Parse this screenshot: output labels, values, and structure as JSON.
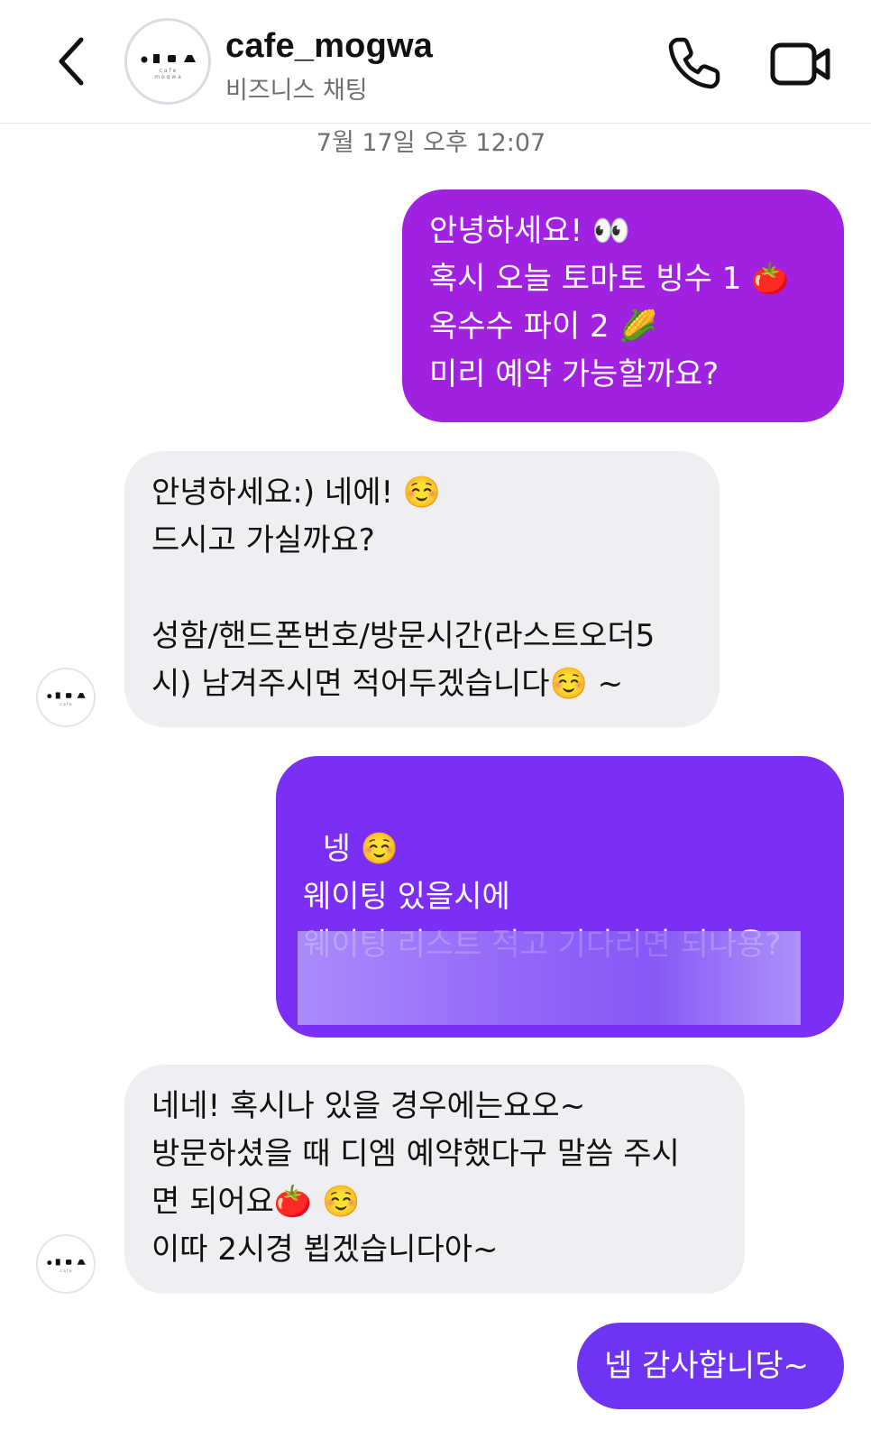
{
  "header": {
    "name": "cafe_mogwa",
    "subtitle": "비즈니스 채팅",
    "avatar_icon": "cafe-logo-icon",
    "back_icon": "chevron-left-icon",
    "call_icon": "phone-icon",
    "video_icon": "video-camera-icon"
  },
  "timestamp": "7월 17일 오후 12:07",
  "messages": [
    {
      "sender": "me",
      "text": "안녕하세요! 👀\n혹시 오늘 토마토 빙수 1 🍅\n옥수수 파이 2 🌽\n미리 예약 가능할까요?",
      "color": "#a022e0"
    },
    {
      "sender": "cafe_mogwa",
      "text": "안녕하세요:) 네에! ☺️\n드시고 가실까요?\n\n성함/핸드폰번호/방문시간(라스트오더5\n시) 남겨주시면 적어두겠습니다☺️ ~",
      "color": "#efeff2"
    },
    {
      "sender": "me",
      "text": "넹 ☺️\n웨이팅 있을시에\n웨이팅 리스트 적고 기다리면 되나용?",
      "color": "#7b2ef4"
    },
    {
      "sender": "cafe_mogwa",
      "text": "네네! 혹시나 있을 경우에는요오~\n방문하셨을 때 디엠 예약했다구 말씀 주시\n면 되어요🍅 ☺️\n이따 2시경 뵙겠습니다아~",
      "color": "#efeff2"
    },
    {
      "sender": "me",
      "text": "넵 감사합니당~",
      "color": "#6f34f2"
    }
  ]
}
